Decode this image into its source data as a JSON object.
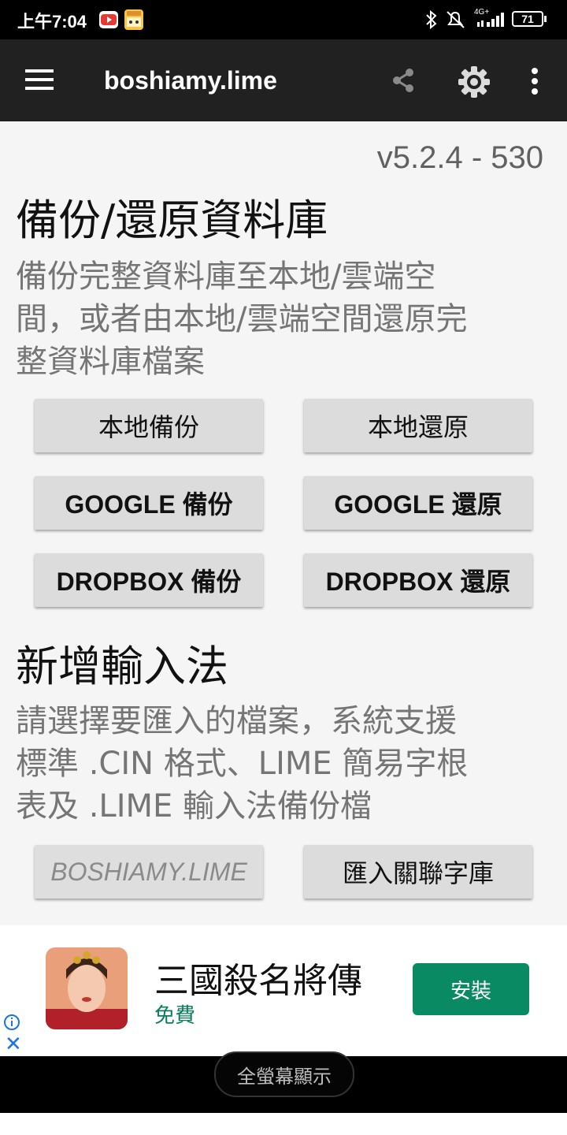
{
  "status_bar": {
    "time": "上午7:04",
    "network": "4G+",
    "battery": "71"
  },
  "app_bar": {
    "title": "boshiamy.lime",
    "icons": [
      "menu-icon",
      "share-icon",
      "settings-gear-icon",
      "more-vert-icon"
    ]
  },
  "version": "v5.2.4 - 530",
  "backup_section": {
    "title": "備份/還原資料庫",
    "description": "備份完整資料庫至本地/雲端空間，或者由本地/雲端空間還原完整資料庫檔案",
    "description_lines": [
      "備份完整資料庫至本地/雲端空",
      "間，或者由本地/雲端空間還原完",
      "整資料庫檔案"
    ],
    "buttons": {
      "local_backup": "本地備份",
      "local_restore": "本地還原",
      "google_backup": "GOOGLE 備份",
      "google_restore": "GOOGLE 還原",
      "dropbox_backup": "DROPBOX 備份",
      "dropbox_restore": "DROPBOX 還原"
    }
  },
  "import_section": {
    "title": "新增輸入法",
    "description_lines": [
      "請選擇要匯入的檔案，系統支援",
      "標準 .CIN 格式、LIME 簡易字根",
      "表及 .LIME 輸入法備份檔"
    ],
    "file_button": "BOSHIAMY.LIME",
    "import_related_button": "匯入關聯字庫"
  },
  "ad": {
    "app_name": "三國殺名將傳",
    "price": "免費",
    "install_label": "安裝"
  },
  "nav": {
    "fullscreen_label": "全螢幕顯示"
  },
  "colors": {
    "app_bar": "#212121",
    "content_bg": "#f5f5f5",
    "button_bg": "#dcdcdc",
    "install_green": "#0a8a62"
  }
}
